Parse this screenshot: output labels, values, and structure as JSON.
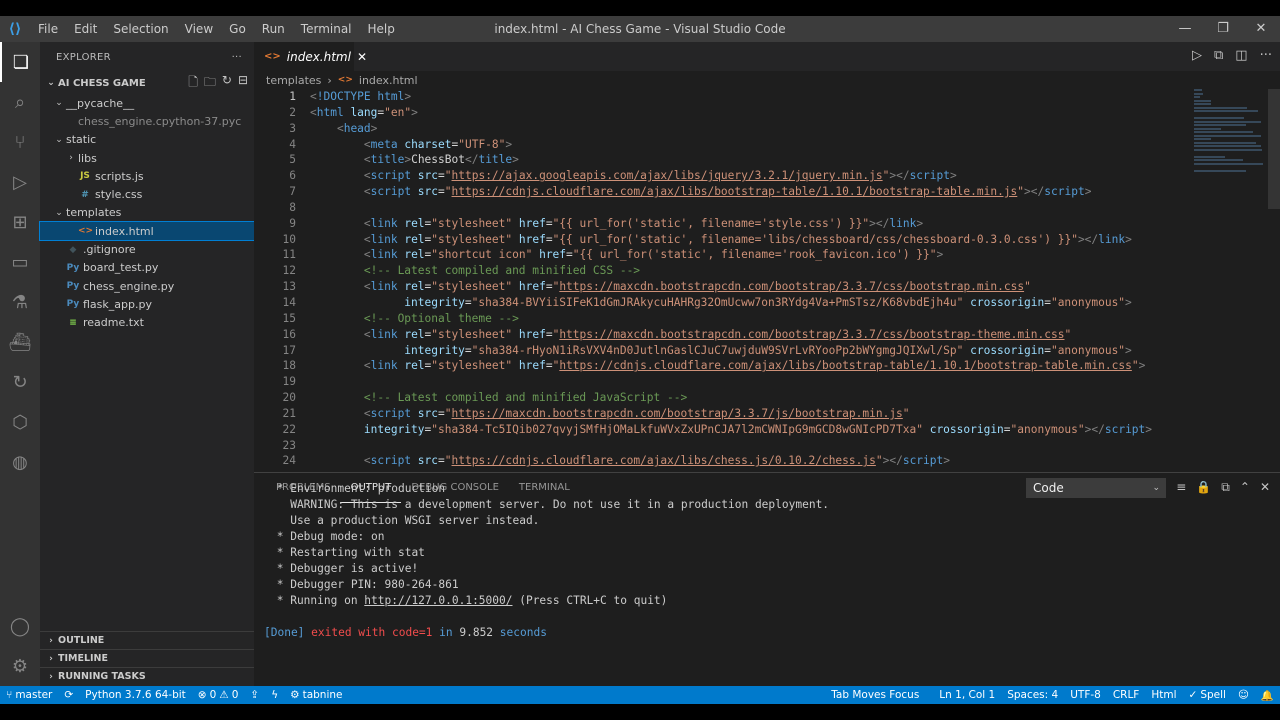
{
  "titlebar": {
    "title": "index.html - AI Chess Game - Visual Studio Code",
    "menu": [
      "File",
      "Edit",
      "Selection",
      "View",
      "Go",
      "Run",
      "Terminal",
      "Help"
    ]
  },
  "sidebar": {
    "header": "EXPLORER",
    "project": "AI CHESS GAME",
    "tree": [
      {
        "label": "__pycache__",
        "kind": "folder-open",
        "depth": 1
      },
      {
        "label": "chess_engine.cpython-37.pyc",
        "kind": "file",
        "depth": 2,
        "dim": true
      },
      {
        "label": "static",
        "kind": "folder-open",
        "depth": 1
      },
      {
        "label": "libs",
        "kind": "folder-closed",
        "depth": 2
      },
      {
        "label": "scripts.js",
        "kind": "js",
        "depth": 2
      },
      {
        "label": "style.css",
        "kind": "css",
        "depth": 2
      },
      {
        "label": "templates",
        "kind": "folder-open",
        "depth": 1
      },
      {
        "label": "index.html",
        "kind": "html",
        "depth": 2,
        "selected": true
      },
      {
        "label": ".gitignore",
        "kind": "git",
        "depth": 1
      },
      {
        "label": "board_test.py",
        "kind": "py",
        "depth": 1
      },
      {
        "label": "chess_engine.py",
        "kind": "py",
        "depth": 1
      },
      {
        "label": "flask_app.py",
        "kind": "py",
        "depth": 1
      },
      {
        "label": "readme.txt",
        "kind": "txt",
        "depth": 1
      }
    ],
    "outline": "OUTLINE",
    "timeline": "TIMELINE",
    "running_tasks": "RUNNING TASKS"
  },
  "editor": {
    "tab_label": "index.html",
    "breadcrumb": [
      "templates",
      "index.html"
    ],
    "current_line": 1,
    "lines": [
      [
        [
          "t-br",
          "<"
        ],
        [
          "t-tag",
          "!DOCTYPE html"
        ],
        [
          "t-br",
          ">"
        ]
      ],
      [
        [
          "t-br",
          "<"
        ],
        [
          "t-tag",
          "html "
        ],
        [
          "t-attr",
          "lang"
        ],
        [
          "t-txt",
          "="
        ],
        [
          "t-str",
          "\"en\""
        ],
        [
          "t-br",
          ">"
        ]
      ],
      [
        [
          "t-txt",
          "    "
        ],
        [
          "t-br",
          "<"
        ],
        [
          "t-tag",
          "head"
        ],
        [
          "t-br",
          ">"
        ]
      ],
      [
        [
          "t-txt",
          "        "
        ],
        [
          "t-br",
          "<"
        ],
        [
          "t-tag",
          "meta "
        ],
        [
          "t-attr",
          "charset"
        ],
        [
          "t-txt",
          "="
        ],
        [
          "t-str",
          "\"UTF-8\""
        ],
        [
          "t-br",
          ">"
        ]
      ],
      [
        [
          "t-txt",
          "        "
        ],
        [
          "t-br",
          "<"
        ],
        [
          "t-tag",
          "title"
        ],
        [
          "t-br",
          ">"
        ],
        [
          "t-txt",
          "ChessBot"
        ],
        [
          "t-br",
          "</"
        ],
        [
          "t-tag",
          "title"
        ],
        [
          "t-br",
          ">"
        ]
      ],
      [
        [
          "t-txt",
          "        "
        ],
        [
          "t-br",
          "<"
        ],
        [
          "t-tag",
          "script "
        ],
        [
          "t-attr",
          "src"
        ],
        [
          "t-txt",
          "="
        ],
        [
          "t-str",
          "\""
        ],
        [
          "t-url",
          "https://ajax.googleapis.com/ajax/libs/jquery/3.2.1/jquery.min.js"
        ],
        [
          "t-str",
          "\""
        ],
        [
          "t-br",
          "></"
        ],
        [
          "t-tag",
          "script"
        ],
        [
          "t-br",
          ">"
        ]
      ],
      [
        [
          "t-txt",
          "        "
        ],
        [
          "t-br",
          "<"
        ],
        [
          "t-tag",
          "script "
        ],
        [
          "t-attr",
          "src"
        ],
        [
          "t-txt",
          "="
        ],
        [
          "t-str",
          "\""
        ],
        [
          "t-url",
          "https://cdnjs.cloudflare.com/ajax/libs/bootstrap-table/1.10.1/bootstrap-table.min.js"
        ],
        [
          "t-str",
          "\""
        ],
        [
          "t-br",
          "></"
        ],
        [
          "t-tag",
          "script"
        ],
        [
          "t-br",
          ">"
        ]
      ],
      [],
      [
        [
          "t-txt",
          "        "
        ],
        [
          "t-br",
          "<"
        ],
        [
          "t-tag",
          "link "
        ],
        [
          "t-attr",
          "rel"
        ],
        [
          "t-txt",
          "="
        ],
        [
          "t-str",
          "\"stylesheet\" "
        ],
        [
          "t-attr",
          "href"
        ],
        [
          "t-txt",
          "="
        ],
        [
          "t-str",
          "\"{{ url_for('static', filename='style.css') }}\""
        ],
        [
          "t-br",
          "></"
        ],
        [
          "t-tag",
          "link"
        ],
        [
          "t-br",
          ">"
        ]
      ],
      [
        [
          "t-txt",
          "        "
        ],
        [
          "t-br",
          "<"
        ],
        [
          "t-tag",
          "link "
        ],
        [
          "t-attr",
          "rel"
        ],
        [
          "t-txt",
          "="
        ],
        [
          "t-str",
          "\"stylesheet\" "
        ],
        [
          "t-attr",
          "href"
        ],
        [
          "t-txt",
          "="
        ],
        [
          "t-str",
          "\"{{ url_for('static', filename='libs/chessboard/css/chessboard-0.3.0.css') }}\""
        ],
        [
          "t-br",
          "></"
        ],
        [
          "t-tag",
          "link"
        ],
        [
          "t-br",
          ">"
        ]
      ],
      [
        [
          "t-txt",
          "        "
        ],
        [
          "t-br",
          "<"
        ],
        [
          "t-tag",
          "link "
        ],
        [
          "t-attr",
          "rel"
        ],
        [
          "t-txt",
          "="
        ],
        [
          "t-str",
          "\"shortcut icon\" "
        ],
        [
          "t-attr",
          "href"
        ],
        [
          "t-txt",
          "="
        ],
        [
          "t-str",
          "\"{{ url_for('static', filename='rook_favicon.ico') }}\""
        ],
        [
          "t-br",
          ">"
        ]
      ],
      [
        [
          "t-txt",
          "        "
        ],
        [
          "t-com",
          "<!-- Latest compiled and minified CSS -->"
        ]
      ],
      [
        [
          "t-txt",
          "        "
        ],
        [
          "t-br",
          "<"
        ],
        [
          "t-tag",
          "link "
        ],
        [
          "t-attr",
          "rel"
        ],
        [
          "t-txt",
          "="
        ],
        [
          "t-str",
          "\"stylesheet\" "
        ],
        [
          "t-attr",
          "href"
        ],
        [
          "t-txt",
          "="
        ],
        [
          "t-str",
          "\""
        ],
        [
          "t-url",
          "https://maxcdn.bootstrapcdn.com/bootstrap/3.3.7/css/bootstrap.min.css"
        ],
        [
          "t-str",
          "\""
        ]
      ],
      [
        [
          "t-txt",
          "              "
        ],
        [
          "t-attr",
          "integrity"
        ],
        [
          "t-txt",
          "="
        ],
        [
          "t-str",
          "\"sha384-BVYiiSIFeK1dGmJRAkycuHAHRg32OmUcww7on3RYdg4Va+PmSTsz/K68vbdEjh4u\" "
        ],
        [
          "t-attr",
          "crossorigin"
        ],
        [
          "t-txt",
          "="
        ],
        [
          "t-str",
          "\"anonymous\""
        ],
        [
          "t-br",
          ">"
        ]
      ],
      [
        [
          "t-txt",
          "        "
        ],
        [
          "t-com",
          "<!-- Optional theme -->"
        ]
      ],
      [
        [
          "t-txt",
          "        "
        ],
        [
          "t-br",
          "<"
        ],
        [
          "t-tag",
          "link "
        ],
        [
          "t-attr",
          "rel"
        ],
        [
          "t-txt",
          "="
        ],
        [
          "t-str",
          "\"stylesheet\" "
        ],
        [
          "t-attr",
          "href"
        ],
        [
          "t-txt",
          "="
        ],
        [
          "t-str",
          "\""
        ],
        [
          "t-url",
          "https://maxcdn.bootstrapcdn.com/bootstrap/3.3.7/css/bootstrap-theme.min.css"
        ],
        [
          "t-str",
          "\""
        ]
      ],
      [
        [
          "t-txt",
          "              "
        ],
        [
          "t-attr",
          "integrity"
        ],
        [
          "t-txt",
          "="
        ],
        [
          "t-str",
          "\"sha384-rHyoN1iRsVXV4nD0JutlnGaslCJuC7uwjduW9SVrLvRYooPp2bWYgmgJQIXwl/Sp\" "
        ],
        [
          "t-attr",
          "crossorigin"
        ],
        [
          "t-txt",
          "="
        ],
        [
          "t-str",
          "\"anonymous\""
        ],
        [
          "t-br",
          ">"
        ]
      ],
      [
        [
          "t-txt",
          "        "
        ],
        [
          "t-br",
          "<"
        ],
        [
          "t-tag",
          "link "
        ],
        [
          "t-attr",
          "rel"
        ],
        [
          "t-txt",
          "="
        ],
        [
          "t-str",
          "\"stylesheet\" "
        ],
        [
          "t-attr",
          "href"
        ],
        [
          "t-txt",
          "="
        ],
        [
          "t-str",
          "\""
        ],
        [
          "t-url",
          "https://cdnjs.cloudflare.com/ajax/libs/bootstrap-table/1.10.1/bootstrap-table.min.css"
        ],
        [
          "t-str",
          "\""
        ],
        [
          "t-br",
          ">"
        ]
      ],
      [],
      [
        [
          "t-txt",
          "        "
        ],
        [
          "t-com",
          "<!-- Latest compiled and minified JavaScript -->"
        ]
      ],
      [
        [
          "t-txt",
          "        "
        ],
        [
          "t-br",
          "<"
        ],
        [
          "t-tag",
          "script "
        ],
        [
          "t-attr",
          "src"
        ],
        [
          "t-txt",
          "="
        ],
        [
          "t-str",
          "\""
        ],
        [
          "t-url",
          "https://maxcdn.bootstrapcdn.com/bootstrap/3.3.7/js/bootstrap.min.js"
        ],
        [
          "t-str",
          "\""
        ]
      ],
      [
        [
          "t-txt",
          "        "
        ],
        [
          "t-attr",
          "integrity"
        ],
        [
          "t-txt",
          "="
        ],
        [
          "t-str",
          "\"sha384-Tc5IQib027qvyjSMfHjOMaLkfuWVxZxUPnCJA7l2mCWNIpG9mGCD8wGNIcPD7Txa\" "
        ],
        [
          "t-attr",
          "crossorigin"
        ],
        [
          "t-txt",
          "="
        ],
        [
          "t-str",
          "\"anonymous\""
        ],
        [
          "t-br",
          "></"
        ],
        [
          "t-tag",
          "script"
        ],
        [
          "t-br",
          ">"
        ]
      ],
      [],
      [
        [
          "t-txt",
          "        "
        ],
        [
          "t-br",
          "<"
        ],
        [
          "t-tag",
          "script "
        ],
        [
          "t-attr",
          "src"
        ],
        [
          "t-txt",
          "="
        ],
        [
          "t-str",
          "\""
        ],
        [
          "t-url",
          "https://cdnjs.cloudflare.com/ajax/libs/chess.js/0.10.2/chess.js"
        ],
        [
          "t-str",
          "\""
        ],
        [
          "t-br",
          "></"
        ],
        [
          "t-tag",
          "script"
        ],
        [
          "t-br",
          ">"
        ]
      ]
    ]
  },
  "panel": {
    "tabs": [
      "PROBLEMS",
      "OUTPUT",
      "DEBUG CONSOLE",
      "TERMINAL"
    ],
    "active_tab": "OUTPUT",
    "channel": "Code",
    "output": [
      " * Environment: production",
      "   WARNING: This is a development server. Do not use it in a production deployment.",
      "   Use a production WSGI server instead.",
      " * Debug mode: on",
      " * Restarting with stat",
      " * Debugger is active!",
      " * Debugger PIN: 980-264-861"
    ],
    "running_prefix": " * Running on ",
    "running_url": "http://127.0.0.1:5000/",
    "running_suffix": " (Press CTRL+C to quit)",
    "done_tag": "[Done]",
    "done_exit": " exited with code=1",
    "done_in": " in ",
    "done_time": "9.852",
    "done_seconds": " seconds"
  },
  "statusbar": {
    "branch": "master",
    "python": "Python 3.7.6 64-bit",
    "errors": "0",
    "warnings": "0",
    "tabnine": "tabnine",
    "tab_moves_focus": "Tab Moves Focus",
    "position": "Ln 1, Col 1",
    "spaces": "Spaces: 4",
    "encoding": "UTF-8",
    "eol": "CRLF",
    "language": "Html",
    "spell": "Spell"
  },
  "colors": {
    "statusbar": "#007acc",
    "selection": "#094771",
    "tab_html_icon": "#e37933"
  }
}
